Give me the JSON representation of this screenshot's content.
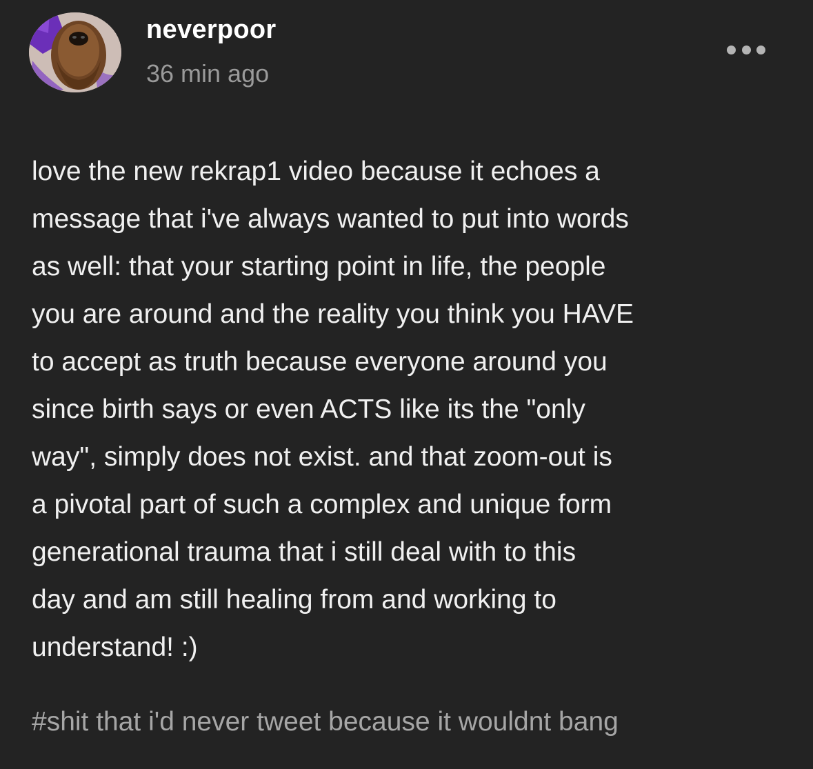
{
  "post": {
    "username": "neverpoor",
    "timestamp": "36 min ago",
    "more_icon": "more-horizontal-icon",
    "body_lines": [
      "love the new rekrap1 video because it echoes a",
      "message that i've always wanted to put into words",
      "as well: that your starting point in life, the people",
      "you are around and the reality you think you HAVE",
      "to accept as truth because everyone around you",
      "since birth says or even ACTS like its the \"only",
      "way\", simply does not exist. and that zoom-out is",
      "a pivotal part of such a complex and unique form",
      "generational trauma that i still deal with to this",
      "day and am still healing from and working to",
      "understand! :)"
    ],
    "tag": "#shit that i'd never tweet because it wouldnt bang"
  },
  "colors": {
    "background": "#232323",
    "username": "#ffffff",
    "timestamp": "#9a9a9a",
    "body": "#f0f0f0",
    "tag": "#a6a6a6",
    "avatar_accent": "#6b2fb8"
  }
}
